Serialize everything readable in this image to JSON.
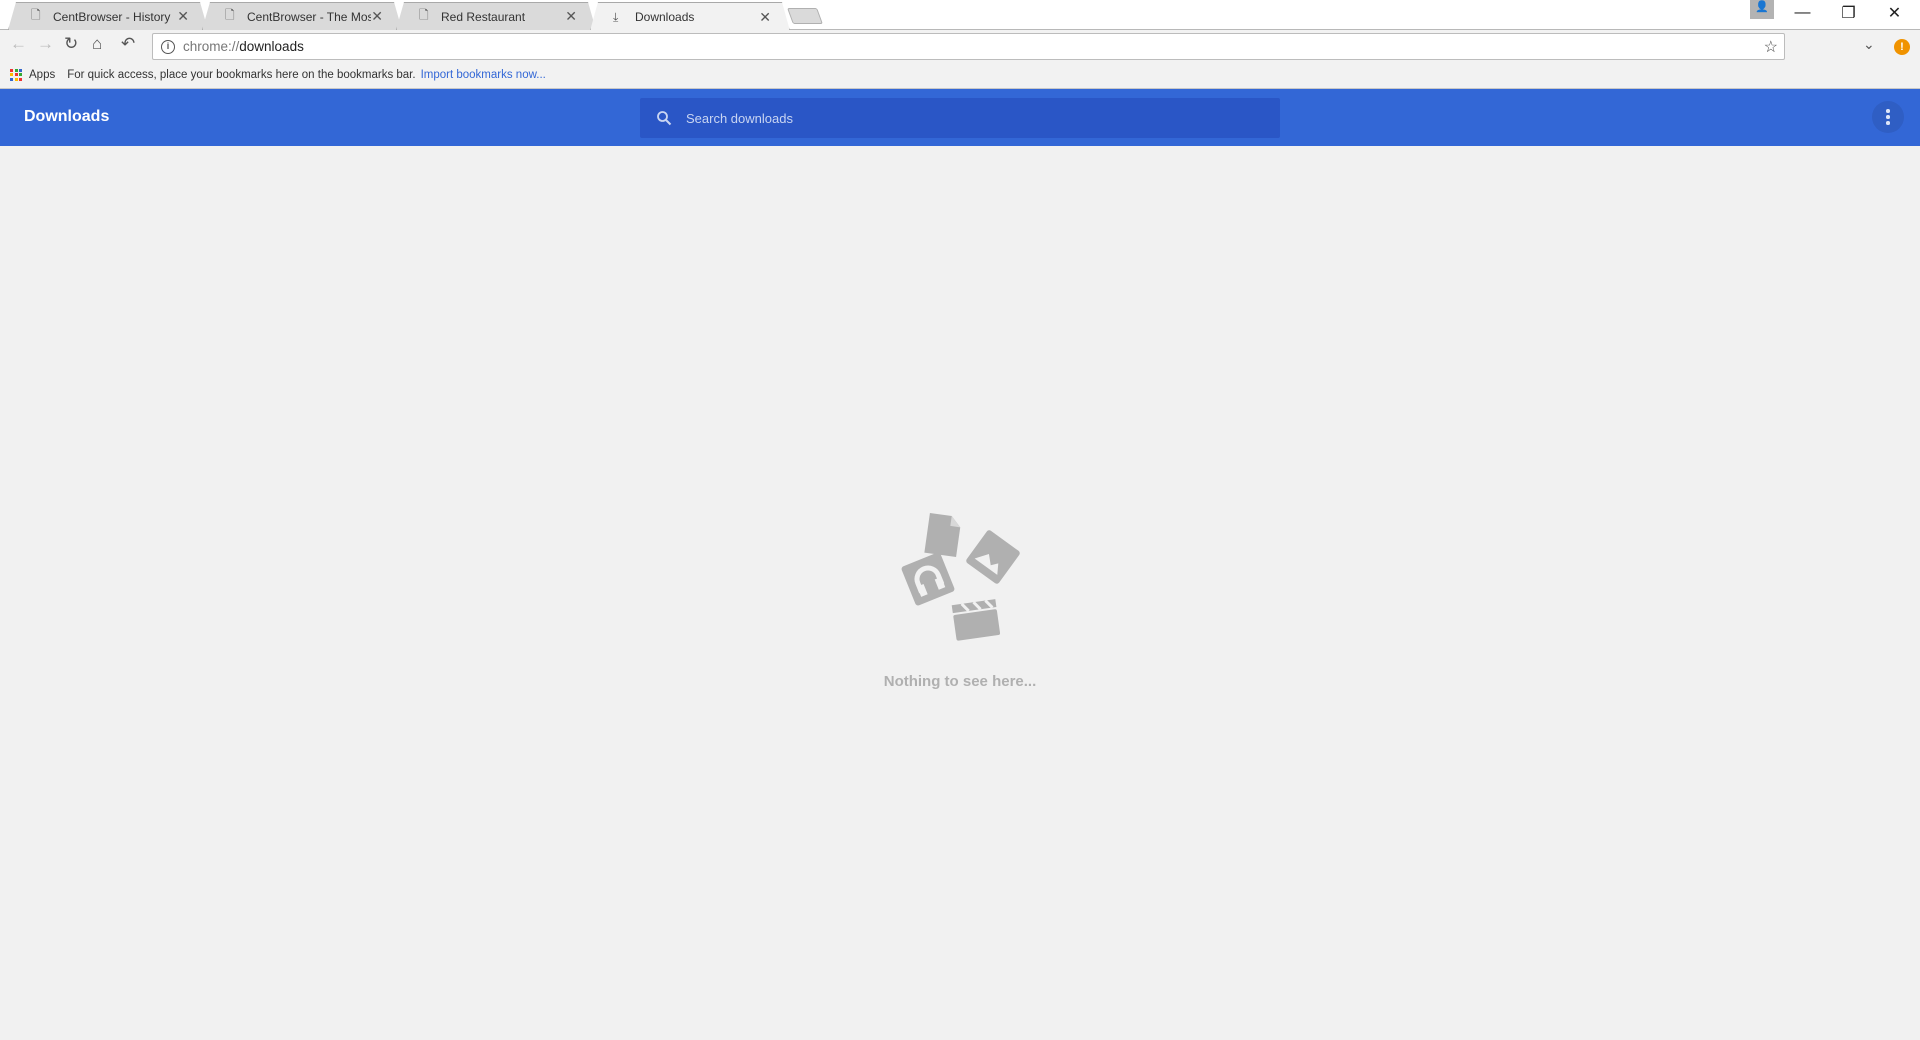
{
  "tabs": [
    {
      "label": "CentBrowser - History",
      "icon": "page-icon"
    },
    {
      "label": "CentBrowser - The Most",
      "icon": "page-icon"
    },
    {
      "label": "Red Restaurant",
      "icon": "page-icon"
    },
    {
      "label": "Downloads",
      "icon": "download-icon",
      "active": true
    }
  ],
  "omnibox": {
    "scheme": "chrome://",
    "host": "downloads"
  },
  "bookmarks": {
    "apps": "Apps",
    "hint": "For quick access, place your bookmarks here on the bookmarks bar.",
    "import": "Import bookmarks now..."
  },
  "page": {
    "title": "Downloads",
    "search_placeholder": "Search downloads",
    "empty_message": "Nothing to see here..."
  },
  "colors": {
    "header": "#3367d6",
    "search": "#2a56c6",
    "warning": "#f09300"
  }
}
